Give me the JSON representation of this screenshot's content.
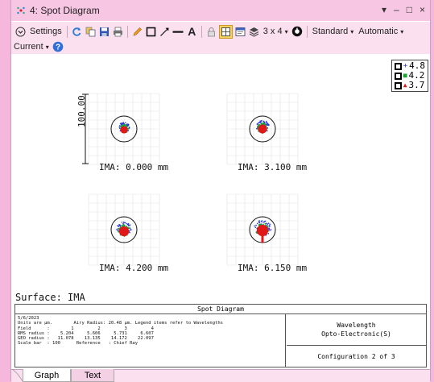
{
  "window": {
    "title": "4: Spot Diagram",
    "controls": [
      "▾",
      "–",
      "□",
      "×"
    ]
  },
  "toolbar": {
    "settings_label": "Settings",
    "sampling_label": "3 x 4",
    "standard_label": "Standard",
    "automatic_label": "Automatic",
    "current_label": "Current",
    "icons": [
      "refresh-icon",
      "copy-icon",
      "save-icon",
      "print-icon",
      "pencil-icon",
      "rectangle-icon",
      "arrow-icon",
      "line-icon",
      "text-icon",
      "lock-icon",
      "grid-icon",
      "window-icon",
      "layers-icon",
      "preset-icon"
    ]
  },
  "legend": {
    "items": [
      {
        "value": "4.8",
        "color": "#2a36d8"
      },
      {
        "value": "4.2",
        "color": "#1aa530"
      },
      {
        "value": "3.7",
        "color": "#e01818"
      }
    ]
  },
  "plot": {
    "scale_label": "100.00",
    "fields": [
      {
        "label": "IMA: 0.000 mm"
      },
      {
        "label": "IMA: 3.100 mm"
      },
      {
        "label": "IMA: 4.200 mm"
      },
      {
        "label": "IMA: 6.150 mm"
      }
    ]
  },
  "surface_label": "Surface: IMA",
  "info": {
    "title": "Spot Diagram",
    "text": "5/6/2023\nUnits are µm.        Airy Radius: 20.48 µm. Legend items refer to Wavelengths\nField      :        1         2         3         4\nRMS radius :    5.204     5.606     5.731     6.607\nGEO radius :   11.078    13.135    14.172    22.097\nScale bar  : 100      Reference   : Chief Ray",
    "wavelength_label": "Wavelength",
    "company": "Opto-Electronic(S)",
    "configuration": "Configuration 2 of 3"
  },
  "tabs": [
    {
      "label": "Graph",
      "active": true
    },
    {
      "label": "Text",
      "active": false
    }
  ]
}
